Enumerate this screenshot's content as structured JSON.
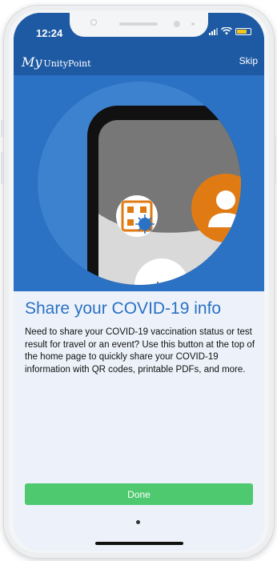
{
  "status_bar": {
    "time": "12:24"
  },
  "header": {
    "logo_prefix": "My",
    "logo_name": "UnityPoint",
    "skip_label": "Skip"
  },
  "onboarding": {
    "title": "Share your COVID-19 info",
    "description": "Need to share your COVID-19 vaccination status or test result for travel or an event? Use this button at the top of the home page to quickly share your COVID-19 information with QR codes, printable PDFs, and more.",
    "done_label": "Done",
    "page_indicator": {
      "current": 1,
      "total": 1
    }
  },
  "colors": {
    "header_blue": "#1e5aa3",
    "hero_blue": "#2b71c4",
    "done_green": "#4ec96f",
    "avatar_orange": "#e07b14"
  },
  "icons": [
    "qr-virus-icon",
    "person-icon",
    "wifi-icon",
    "battery-icon",
    "signal-icon"
  ]
}
